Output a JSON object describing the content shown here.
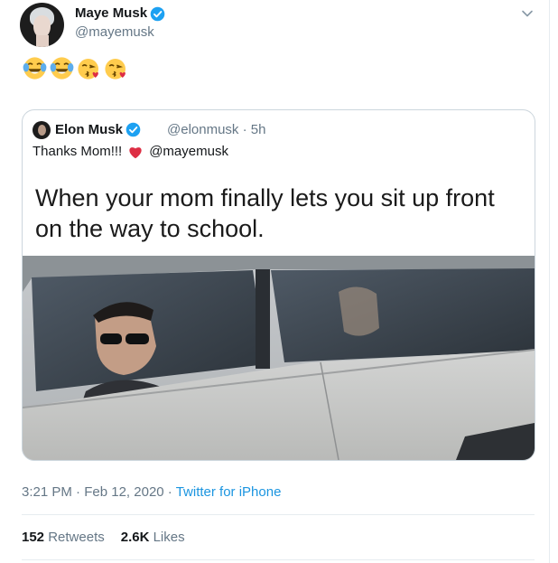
{
  "author": {
    "name": "Maye Musk",
    "handle": "@mayemusk",
    "avatar_icon": "profile-photo-avatar",
    "verified_icon": "verified-badge-icon"
  },
  "tweet": {
    "emojis": [
      "face-with-tears-of-joy",
      "face-with-tears-of-joy",
      "face-blowing-a-kiss",
      "face-blowing-a-kiss"
    ]
  },
  "quoted_tweet": {
    "name": "Elon Musk",
    "handle": "@elonmusk",
    "separator": "·",
    "time": "5h",
    "text_before": "Thanks Mom!!!",
    "mention": "@mayemusk",
    "heart_icon": "red-heart-icon",
    "meme_caption": "When your mom finally lets you sit up front on the way to school."
  },
  "meta": {
    "time": "3:21 PM",
    "separator": "·",
    "date": "Feb 12, 2020",
    "source": "Twitter for iPhone"
  },
  "stats": {
    "retweets_count": "152",
    "retweets_label": "Retweets",
    "likes_count": "2.6K",
    "likes_label": "Likes"
  },
  "colors": {
    "link": "#1b95e0",
    "verified": "#1da1f2",
    "muted": "#657786",
    "border": "#ccd6dd"
  }
}
